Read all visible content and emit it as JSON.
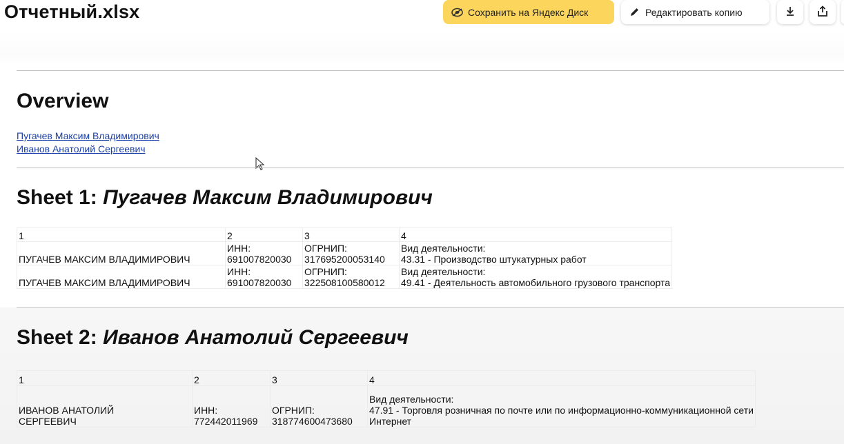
{
  "header": {
    "file_title": "Отчетный.xlsx",
    "save_label": "Сохранить на Яндекс Диск",
    "edit_label": "Редактировать копию",
    "accent_color": "#fcd55c"
  },
  "icons": {
    "save": "disk-icon",
    "edit": "pencil-icon",
    "download": "download-icon",
    "share": "share-icon"
  },
  "overview": {
    "title": "Overview",
    "links": [
      "Пугачев Максим Владимирович",
      "Иванов Анатолий Сергеевич"
    ]
  },
  "sheet1": {
    "prefix": "Sheet 1:",
    "name": "Пугачев Максим Владимирович",
    "columns": [
      "1",
      "2",
      "3",
      "4"
    ],
    "rows": [
      {
        "name": "ПУГАЧЕВ МАКСИМ ВЛАДИМИРОВИЧ",
        "inn_label": "ИНН:",
        "inn": "691007820030",
        "ogrnip_label": "ОГРНИП:",
        "ogrnip": "317695200053140",
        "activity_label": "Вид деятельности:",
        "activity": "43.31 - Производство штукатурных работ"
      },
      {
        "name": "ПУГАЧЕВ МАКСИМ ВЛАДИМИРОВИЧ",
        "inn_label": "ИНН:",
        "inn": "691007820030",
        "ogrnip_label": "ОГРНИП:",
        "ogrnip": "322508100580012",
        "activity_label": "Вид деятельности:",
        "activity": "49.41 - Деятельность автомобильного грузового транспорта"
      }
    ]
  },
  "sheet2": {
    "prefix": "Sheet 2:",
    "name": "Иванов Анатолий Сергеевич",
    "columns": [
      "1",
      "2",
      "3",
      "4"
    ],
    "rows": [
      {
        "name_line1": "ИВАНОВ АНАТОЛИЙ",
        "name_line2": "СЕРГЕЕВИЧ",
        "inn_label": "ИНН:",
        "inn": "772442011969",
        "ogrnip_label": "ОГРНИП:",
        "ogrnip": "318774600473680",
        "activity_label": "Вид деятельности:",
        "activity_line1": "47.91 - Торговля розничная по почте или по информационно-коммуникационной сети",
        "activity_line2": "Интернет"
      }
    ]
  }
}
